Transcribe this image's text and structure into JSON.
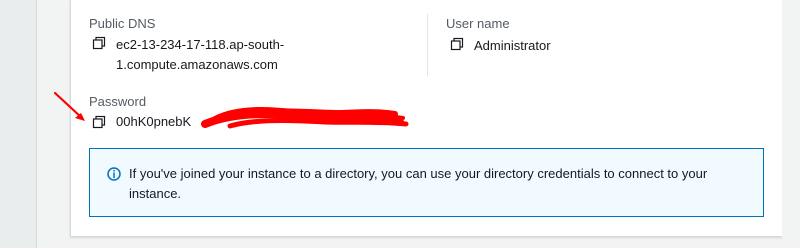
{
  "left_pane": {},
  "connection": {
    "public_dns": {
      "label": "Public DNS",
      "line1": "ec2-13-234-17-118.ap-south-",
      "line2": "1.compute.amazonaws.com"
    },
    "user_name": {
      "label": "User name",
      "value": "Administrator"
    },
    "password": {
      "label": "Password",
      "value": "00hK0pnebK"
    }
  },
  "info": {
    "text_line1": "If you've joined your instance to a directory, you can use your directory credentials to connect to your",
    "text_line2": "instance."
  },
  "annotations": {
    "arrow_color": "#ff0000",
    "redaction_color": "#ff0000"
  },
  "colors": {
    "info_border": "#0073bb",
    "info_bg": "#f1faff",
    "label": "#545b64",
    "text": "#16191f"
  }
}
